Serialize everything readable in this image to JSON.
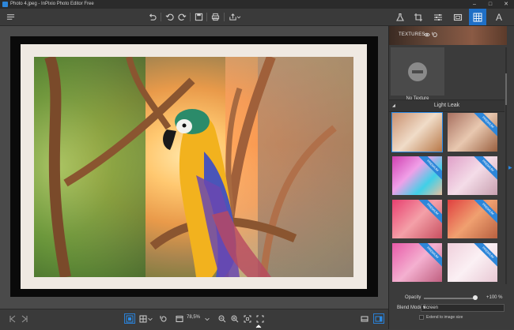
{
  "window": {
    "title": "Photo 4.jpeg - InPixio Photo Editor Free",
    "controls": [
      "minimize",
      "maximize",
      "close"
    ]
  },
  "toolbar": {
    "left": [
      "menu-icon"
    ],
    "center": [
      "undo-icon",
      "undo-step-icon",
      "redo-step-icon",
      "save-icon",
      "print-icon",
      "share-icon"
    ],
    "panel_tabs": [
      {
        "name": "flask-icon",
        "active": false
      },
      {
        "name": "crop-icon",
        "active": false
      },
      {
        "name": "sliders-icon",
        "active": false
      },
      {
        "name": "frame-icon",
        "active": false
      },
      {
        "name": "texture-grid-icon",
        "active": true
      },
      {
        "name": "text-icon",
        "label": "A",
        "active": false
      }
    ]
  },
  "panel": {
    "header_label": "TEXTURES",
    "no_texture_label": "No Texture",
    "group_label": "Light Leak",
    "premium_label": "PREMIUM",
    "thumbnails": [
      {
        "tone": "#e9c7a9",
        "premium": false,
        "selected": true
      },
      {
        "tone": "#d7b0a0",
        "premium": true,
        "selected": false
      },
      {
        "tone": "#e6a0d8",
        "premium": true,
        "selected": false
      },
      {
        "tone": "#e8c0d0",
        "premium": true,
        "selected": false
      },
      {
        "tone": "#f07890",
        "premium": true,
        "selected": false
      },
      {
        "tone": "#e09060",
        "premium": true,
        "selected": false
      },
      {
        "tone": "#f27ab8",
        "premium": true,
        "selected": false
      },
      {
        "tone": "#f2e0e8",
        "premium": true,
        "selected": false
      }
    ],
    "opacity_label": "Opacity",
    "opacity_value_text": "+100 %",
    "opacity_value": 100,
    "blend_label": "Blend Mode",
    "blend_value": "Screen",
    "extend_label": "Extend to image size"
  },
  "bottom": {
    "zoom": "78,5%",
    "icons": [
      "prev-icon",
      "next-icon",
      "fit-view-icon",
      "grid-view-icon",
      "rotate-icon",
      "compare-icon",
      "zoom-out-icon",
      "zoom-in-icon",
      "fit-icon",
      "fullscreen-icon",
      "chevron-up-icon",
      "filmstrip-icon",
      "panel-toggle-icon"
    ]
  },
  "colors": {
    "accent": "#1f6fc6",
    "bg": "#3c3c3c",
    "panel": "#3b3b3b"
  }
}
